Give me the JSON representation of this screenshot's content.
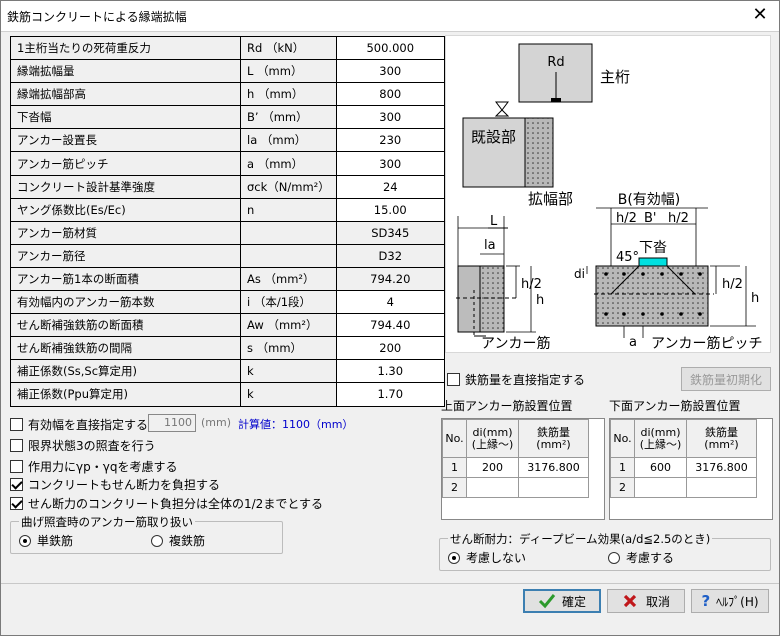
{
  "window": {
    "title": "鉄筋コンクリートによる縁端拡幅",
    "close_glyph": "✕"
  },
  "params": [
    {
      "label": "1主桁当たりの死荷重反力",
      "symbol": "Rd （kN）",
      "value": "500.000"
    },
    {
      "label": "縁端拡幅量",
      "symbol": "L （mm）",
      "value": "300"
    },
    {
      "label": "縁端拡幅部高",
      "symbol": "h （mm）",
      "value": "800"
    },
    {
      "label": "下沓幅",
      "symbol": "B’ （mm）",
      "value": "300"
    },
    {
      "label": "アンカー設置長",
      "symbol": "la （mm）",
      "value": "230"
    },
    {
      "label": "アンカー筋ピッチ",
      "symbol": "a （mm）",
      "value": "300"
    },
    {
      "label": "コンクリート設計基準強度",
      "symbol": "σck（N/mm²）",
      "value": "24"
    },
    {
      "label": "ヤング係数比(Es/Ec)",
      "symbol": "n",
      "value": "15.00"
    },
    {
      "label": "アンカー筋材質",
      "symbol": "",
      "value": "SD345"
    },
    {
      "label": "アンカー筋径",
      "symbol": "",
      "value": "D32"
    },
    {
      "label": "アンカー筋1本の断面積",
      "symbol": "As （mm²）",
      "value": "794.20"
    },
    {
      "label": "有効幅内のアンカー筋本数",
      "symbol": "i （本/1段）",
      "value": "4"
    },
    {
      "label": "せん断補強鉄筋の断面積",
      "symbol": "Aw （mm²）",
      "value": "794.40"
    },
    {
      "label": "せん断補強鉄筋の間隔",
      "symbol": "s （mm）",
      "value": "200"
    },
    {
      "label": "補正係数(Ss,Sc算定用)",
      "symbol": "k",
      "value": "1.30"
    },
    {
      "label": "補正係数(Ppu算定用)",
      "symbol": "k",
      "value": "1.70"
    }
  ],
  "figure": {
    "rd": "Rd",
    "main_girder": "主桁",
    "existing": "既設部",
    "widening": "拡幅部",
    "B_label": "B(有効幅)",
    "h2": "h/2",
    "Bp": "B'",
    "L": "L",
    "la": "la",
    "h": "h",
    "shoe": "下沓",
    "angle": "45°",
    "di": "di",
    "anchor": "アンカー筋",
    "a": "a",
    "pitch": "アンカー筋ピッチ"
  },
  "options": {
    "eff_width": {
      "label": "有効幅を直接指定する",
      "checked": false,
      "value": "1100",
      "unit": "(mm)",
      "calc": "計算値：1100（mm）"
    },
    "limit3": {
      "label": "限界状態3の照査を行う",
      "checked": false
    },
    "gamma": {
      "label": "作用力にγp・γqを考慮する",
      "checked": false
    },
    "concrete_shear": {
      "label": "コンクリートもせん断力を負担する",
      "checked": true
    },
    "half_shear": {
      "label": "せん断力のコンクリート負担分は全体の1/2までとする",
      "checked": true
    }
  },
  "bending": {
    "title": "曲げ照査時のアンカー筋取り扱い",
    "single": "単鉄筋",
    "double": "複鉄筋",
    "selected": "single"
  },
  "rebar_direct": {
    "label": "鉄筋量を直接指定する",
    "checked": false,
    "init_button": "鉄筋量初期化"
  },
  "upper": {
    "title": "上面アンカー筋設置位置",
    "head": {
      "no": "No.",
      "di": "di(mm)\n(上縁〜)",
      "as": "鉄筋量\n(mm²)"
    },
    "rows": [
      {
        "no": "1",
        "di": "200",
        "as": "3176.800"
      },
      {
        "no": "2",
        "di": "",
        "as": ""
      }
    ]
  },
  "lower": {
    "title": "下面アンカー筋設置位置",
    "head": {
      "no": "No.",
      "di": "di(mm)\n(上縁〜)",
      "as": "鉄筋量\n(mm²)"
    },
    "rows": [
      {
        "no": "1",
        "di": "600",
        "as": "3176.800"
      },
      {
        "no": "2",
        "di": "",
        "as": ""
      }
    ]
  },
  "deep_beam": {
    "title": "せん断耐力：ディープビーム効果(a/d≦2.5のとき)",
    "no": "考慮しない",
    "yes": "考慮する",
    "selected": "no"
  },
  "buttons": {
    "ok": "確定",
    "cancel": "取消",
    "help": "ﾍﾙﾌﾟ(H)"
  }
}
